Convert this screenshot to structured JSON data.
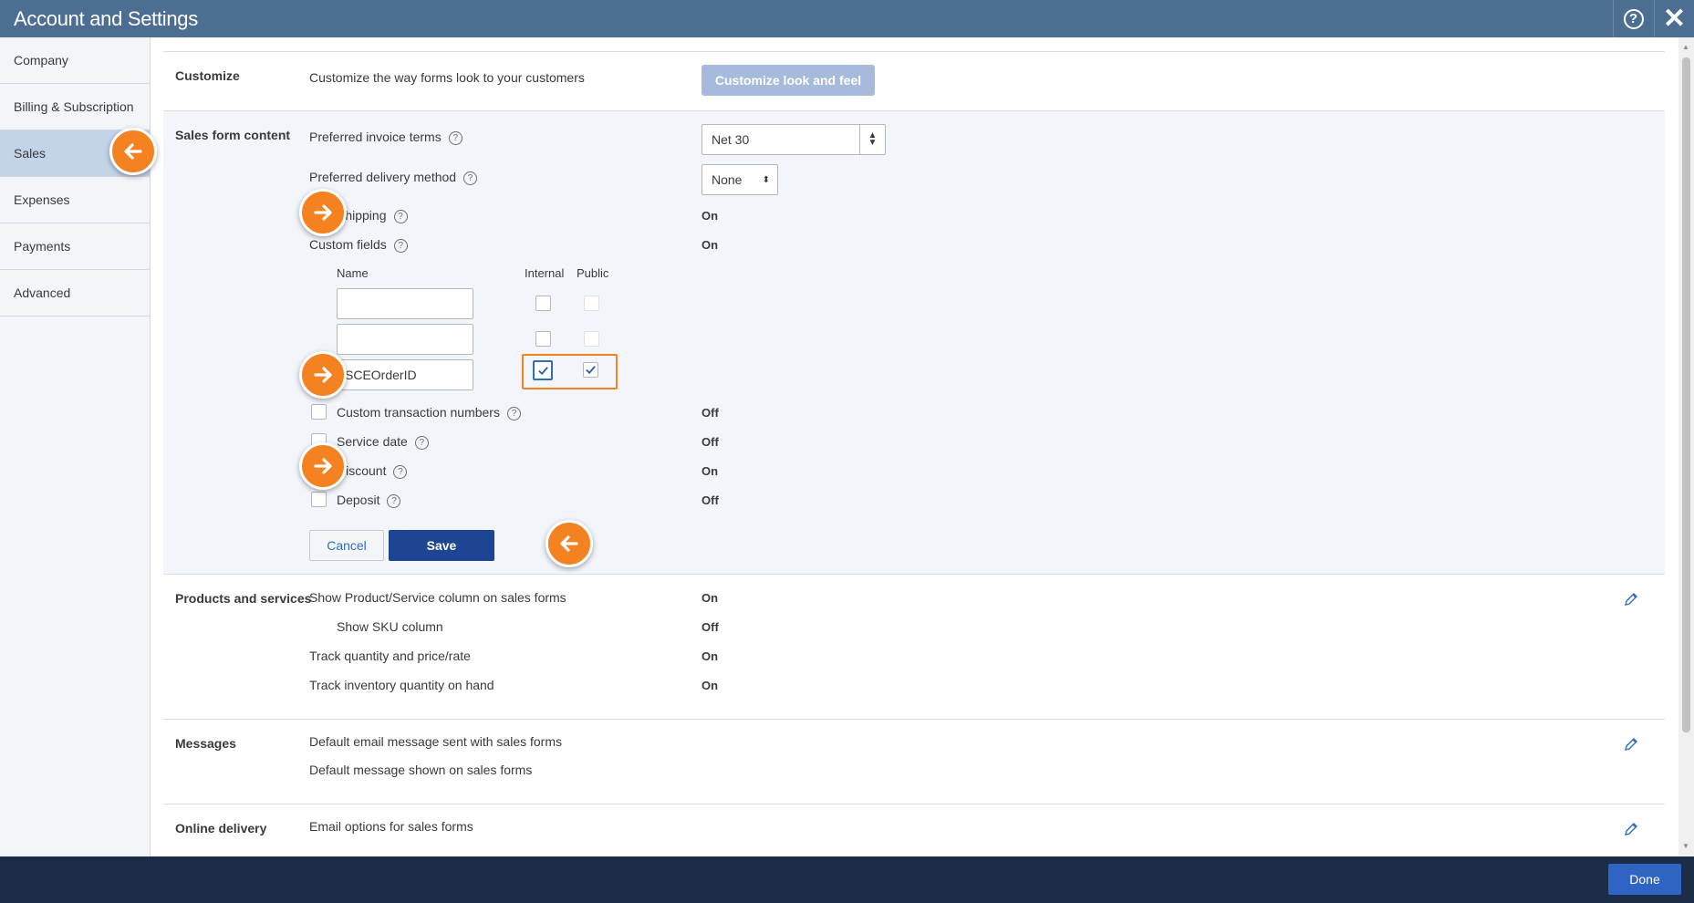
{
  "window": {
    "title": "Account and Settings"
  },
  "sidebar": {
    "items": [
      {
        "label": "Company"
      },
      {
        "label": "Billing & Subscription"
      },
      {
        "label": "Sales"
      },
      {
        "label": "Expenses"
      },
      {
        "label": "Payments"
      },
      {
        "label": "Advanced"
      }
    ],
    "active": "Sales"
  },
  "customize": {
    "title": "Customize",
    "description": "Customize the way forms look to your customers",
    "button_label": "Customize look and feel"
  },
  "sales_form": {
    "title": "Sales form content",
    "invoice_terms_label": "Preferred invoice terms",
    "invoice_terms_value": "Net 30",
    "delivery_label": "Preferred delivery method",
    "delivery_value": "None",
    "shipping_label": "Shipping",
    "shipping_value": "On",
    "custom_fields_label": "Custom fields",
    "custom_fields_value": "On",
    "col_name": "Name",
    "col_internal": "Internal",
    "col_public": "Public",
    "custom_field_rows": [
      {
        "name": "",
        "internal": false,
        "public": false
      },
      {
        "name": "",
        "internal": false,
        "public": false
      },
      {
        "name": "SCEOrderID",
        "internal": true,
        "public": true
      }
    ],
    "custom_txn_label": "Custom transaction numbers",
    "custom_txn_value": "Off",
    "service_date_label": "Service date",
    "service_date_value": "Off",
    "discount_label": "Discount",
    "discount_value": "On",
    "deposit_label": "Deposit",
    "deposit_value": "Off",
    "cancel_label": "Cancel",
    "save_label": "Save"
  },
  "products": {
    "title": "Products and services",
    "rows": [
      {
        "label": "Show Product/Service column on sales forms",
        "value": "On"
      },
      {
        "label": "Show SKU column",
        "value": "Off"
      },
      {
        "label": "Track quantity and price/rate",
        "value": "On"
      },
      {
        "label": "Track inventory quantity on hand",
        "value": "On"
      }
    ]
  },
  "messages": {
    "title": "Messages",
    "rows": [
      {
        "label": "Default email message sent with sales forms"
      },
      {
        "label": "Default message shown on sales forms"
      }
    ]
  },
  "online_delivery": {
    "title": "Online delivery",
    "rows": [
      {
        "label": "Email options for sales forms"
      }
    ]
  },
  "footer": {
    "done_label": "Done"
  },
  "colors": {
    "header": "#4d6e93",
    "footer": "#1b2d46",
    "accent_orange": "#f58220",
    "save_blue": "#1e4594",
    "active_sidebar": "#c3d3e8"
  }
}
